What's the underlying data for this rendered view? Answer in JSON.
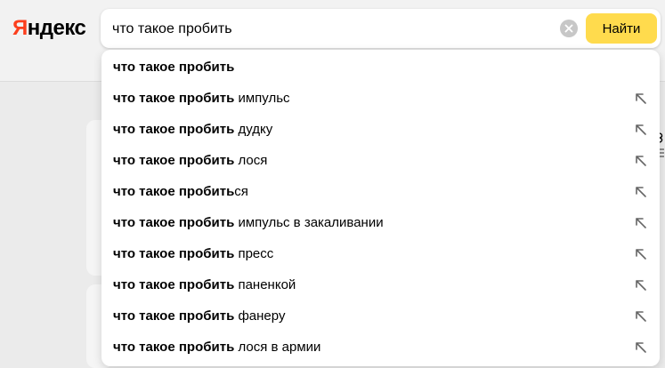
{
  "header": {
    "logo_first": "Я",
    "logo_rest": "ндекс",
    "search_value": "что такое пробить",
    "search_button_label": "Найти"
  },
  "suggestions": [
    {
      "bold": "что такое пробить",
      "rest": ""
    },
    {
      "bold": "что такое пробить",
      "rest": " импульс"
    },
    {
      "bold": "что такое пробить",
      "rest": " дудку"
    },
    {
      "bold": "что такое пробить",
      "rest": " лося"
    },
    {
      "bold": "что такое пробить",
      "rest": "ся"
    },
    {
      "bold": "что такое пробить",
      "rest": " импульс в закаливании"
    },
    {
      "bold": "что такое пробить",
      "rest": " пресс"
    },
    {
      "bold": "что такое пробить",
      "rest": " паненкой"
    },
    {
      "bold": "что такое пробить",
      "rest": " фанеру"
    },
    {
      "bold": "что такое пробить",
      "rest": " лося в армии"
    }
  ],
  "icons": {
    "clear": "clear-circle-x-icon",
    "suggestion_insert": "arrow-up-left-icon"
  },
  "colors": {
    "logo_accent": "#fc3f1d",
    "search_button": "#ffdb4d"
  }
}
